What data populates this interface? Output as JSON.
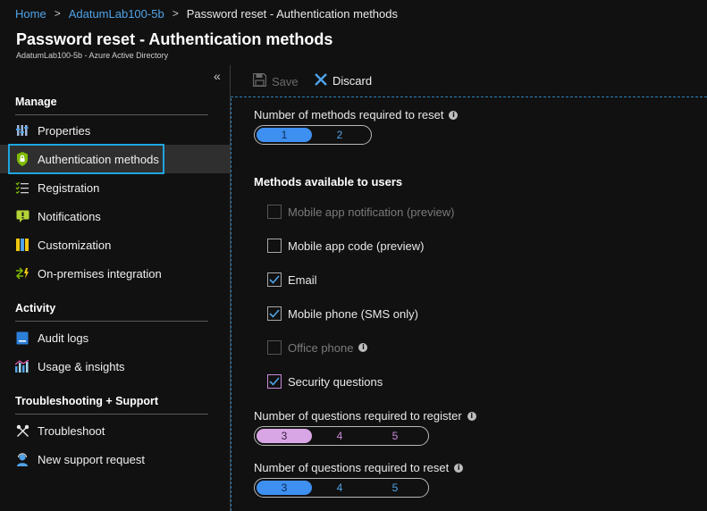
{
  "breadcrumb": {
    "home": "Home",
    "tenant": "AdatumLab100-5b",
    "current": "Password reset - Authentication methods",
    "separator": ">"
  },
  "blade": {
    "title": "Password reset - Authentication methods",
    "subtitle": "AdatumLab100-5b - Azure Active Directory"
  },
  "sidebar": {
    "collapse_glyph": "«",
    "sections": {
      "manage": "Manage",
      "activity": "Activity",
      "troubleshooting": "Troubleshooting + Support"
    },
    "items": [
      {
        "label": "Properties",
        "icon": "properties-icon"
      },
      {
        "label": "Authentication methods",
        "icon": "shield-icon",
        "selected": true
      },
      {
        "label": "Registration",
        "icon": "checklist-icon"
      },
      {
        "label": "Notifications",
        "icon": "notification-icon"
      },
      {
        "label": "Customization",
        "icon": "customization-icon"
      },
      {
        "label": "On-premises integration",
        "icon": "sync-icon"
      },
      {
        "label": "Audit logs",
        "icon": "audit-log-icon"
      },
      {
        "label": "Usage & insights",
        "icon": "insights-icon"
      },
      {
        "label": "Troubleshoot",
        "icon": "tools-icon"
      },
      {
        "label": "New support request",
        "icon": "support-icon"
      }
    ]
  },
  "toolbar": {
    "save_label": "Save",
    "discard_label": "Discard"
  },
  "form": {
    "methods_required_label": "Number of methods required to reset",
    "methods_required_options": [
      "1",
      "2"
    ],
    "methods_required_selected": "1",
    "methods_available_title": "Methods available to users",
    "methods": [
      {
        "label": "Mobile app notification (preview)",
        "checked": false,
        "disabled": true
      },
      {
        "label": "Mobile app code (preview)",
        "checked": false,
        "disabled": false
      },
      {
        "label": "Email",
        "checked": true,
        "disabled": false
      },
      {
        "label": "Mobile phone (SMS only)",
        "checked": true,
        "disabled": false
      },
      {
        "label": "Office phone",
        "checked": false,
        "disabled": true,
        "info": true
      },
      {
        "label": "Security questions",
        "checked": true,
        "disabled": false
      }
    ],
    "questions_register_label": "Number of questions required to register",
    "questions_register_options": [
      "3",
      "4",
      "5"
    ],
    "questions_register_selected": "3",
    "questions_reset_label": "Number of questions required to reset",
    "questions_reset_options": [
      "3",
      "4",
      "5"
    ],
    "questions_reset_selected": "3"
  },
  "colors": {
    "accent_blue": "#3d8ff0",
    "link_blue": "#4fa3e8",
    "selection_border": "#1ea5e0",
    "pink_selected": "#d8a6e4"
  }
}
